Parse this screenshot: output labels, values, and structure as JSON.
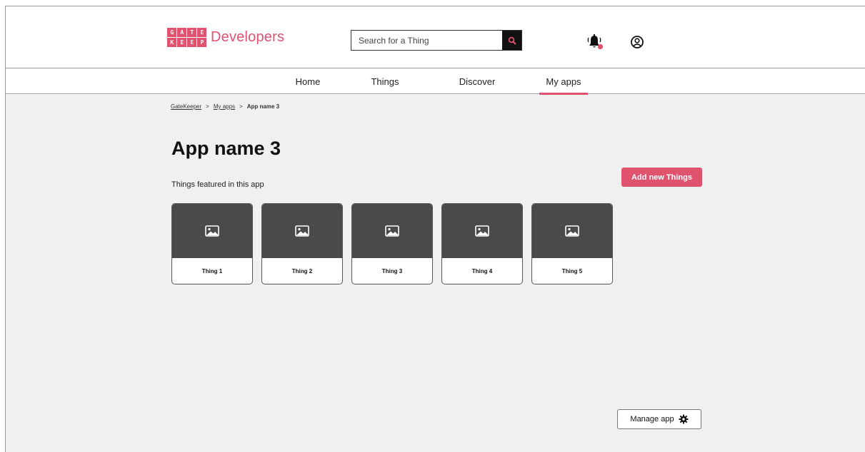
{
  "brand": {
    "logo_letters": [
      "G",
      "A",
      "T",
      "E",
      "K",
      "E",
      "E",
      "P",
      "E",
      "R"
    ],
    "name": "Developers",
    "accent_color": "#e0536f"
  },
  "search": {
    "placeholder": "Search for a Thing",
    "icon": "search-icon"
  },
  "header_icons": {
    "notifications": "bell-icon",
    "profile": "user-circle-icon"
  },
  "nav": {
    "items": [
      {
        "label": "Home",
        "active": false
      },
      {
        "label": "Things",
        "active": false
      },
      {
        "label": "Discover",
        "active": false
      },
      {
        "label": "My apps",
        "active": true
      }
    ]
  },
  "breadcrumb": {
    "items": [
      "GateKeeper",
      "My apps",
      "App name 3"
    ],
    "separator": ">"
  },
  "page": {
    "title": "App name 3",
    "subtitle": "Things featured in this app",
    "add_button": "Add new Things",
    "manage_button": "Manage app"
  },
  "things": [
    {
      "label": "Thing 1"
    },
    {
      "label": "Thing 2"
    },
    {
      "label": "Thing 3"
    },
    {
      "label": "Thing 4"
    },
    {
      "label": "Thing 5"
    }
  ]
}
